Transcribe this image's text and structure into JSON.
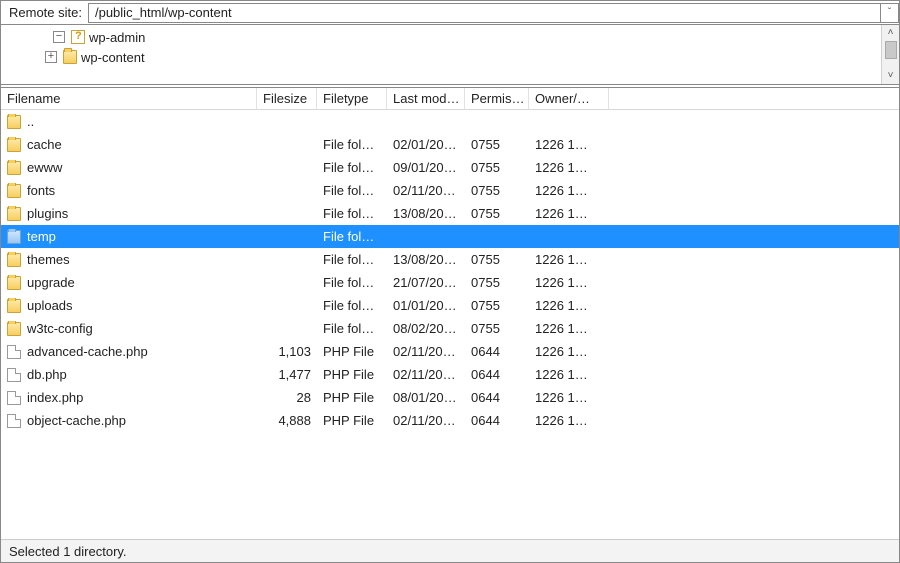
{
  "path": {
    "label": "Remote site:",
    "value": "/public_html/wp-content"
  },
  "tree": {
    "items": [
      {
        "icon": "unknown",
        "expander": "minus",
        "label": "wp-admin"
      },
      {
        "icon": "folder",
        "expander": "plus",
        "label": "wp-content"
      }
    ]
  },
  "headers": {
    "name": "Filename",
    "size": "Filesize",
    "type": "Filetype",
    "mod": "Last mod…",
    "perm": "Permis…",
    "own": "Owner/…"
  },
  "rows": [
    {
      "icon": "folder",
      "name": "..",
      "size": "",
      "type": "",
      "mod": "",
      "perm": "",
      "own": "",
      "sel": false
    },
    {
      "icon": "folder",
      "name": "cache",
      "size": "",
      "type": "File fol…",
      "mod": "02/01/20…",
      "perm": "0755",
      "own": "1226 1…",
      "sel": false
    },
    {
      "icon": "folder",
      "name": "ewww",
      "size": "",
      "type": "File fol…",
      "mod": "09/01/20…",
      "perm": "0755",
      "own": "1226 1…",
      "sel": false
    },
    {
      "icon": "folder",
      "name": "fonts",
      "size": "",
      "type": "File fol…",
      "mod": "02/11/20…",
      "perm": "0755",
      "own": "1226 1…",
      "sel": false
    },
    {
      "icon": "folder",
      "name": "plugins",
      "size": "",
      "type": "File fol…",
      "mod": "13/08/20…",
      "perm": "0755",
      "own": "1226 1…",
      "sel": false
    },
    {
      "icon": "folder",
      "name": "temp",
      "size": "",
      "type": "File fol…",
      "mod": "",
      "perm": "",
      "own": "",
      "sel": true
    },
    {
      "icon": "folder",
      "name": "themes",
      "size": "",
      "type": "File fol…",
      "mod": "13/08/20…",
      "perm": "0755",
      "own": "1226 1…",
      "sel": false
    },
    {
      "icon": "folder",
      "name": "upgrade",
      "size": "",
      "type": "File fol…",
      "mod": "21/07/20…",
      "perm": "0755",
      "own": "1226 1…",
      "sel": false
    },
    {
      "icon": "folder",
      "name": "uploads",
      "size": "",
      "type": "File fol…",
      "mod": "01/01/20…",
      "perm": "0755",
      "own": "1226 1…",
      "sel": false
    },
    {
      "icon": "folder",
      "name": "w3tc-config",
      "size": "",
      "type": "File fol…",
      "mod": "08/02/20…",
      "perm": "0755",
      "own": "1226 1…",
      "sel": false
    },
    {
      "icon": "file",
      "name": "advanced-cache.php",
      "size": "1,103",
      "type": "PHP File",
      "mod": "02/11/20…",
      "perm": "0644",
      "own": "1226 1…",
      "sel": false
    },
    {
      "icon": "file",
      "name": "db.php",
      "size": "1,477",
      "type": "PHP File",
      "mod": "02/11/20…",
      "perm": "0644",
      "own": "1226 1…",
      "sel": false
    },
    {
      "icon": "file",
      "name": "index.php",
      "size": "28",
      "type": "PHP File",
      "mod": "08/01/20…",
      "perm": "0644",
      "own": "1226 1…",
      "sel": false
    },
    {
      "icon": "file",
      "name": "object-cache.php",
      "size": "4,888",
      "type": "PHP File",
      "mod": "02/11/20…",
      "perm": "0644",
      "own": "1226 1…",
      "sel": false
    }
  ],
  "status": "Selected 1 directory."
}
